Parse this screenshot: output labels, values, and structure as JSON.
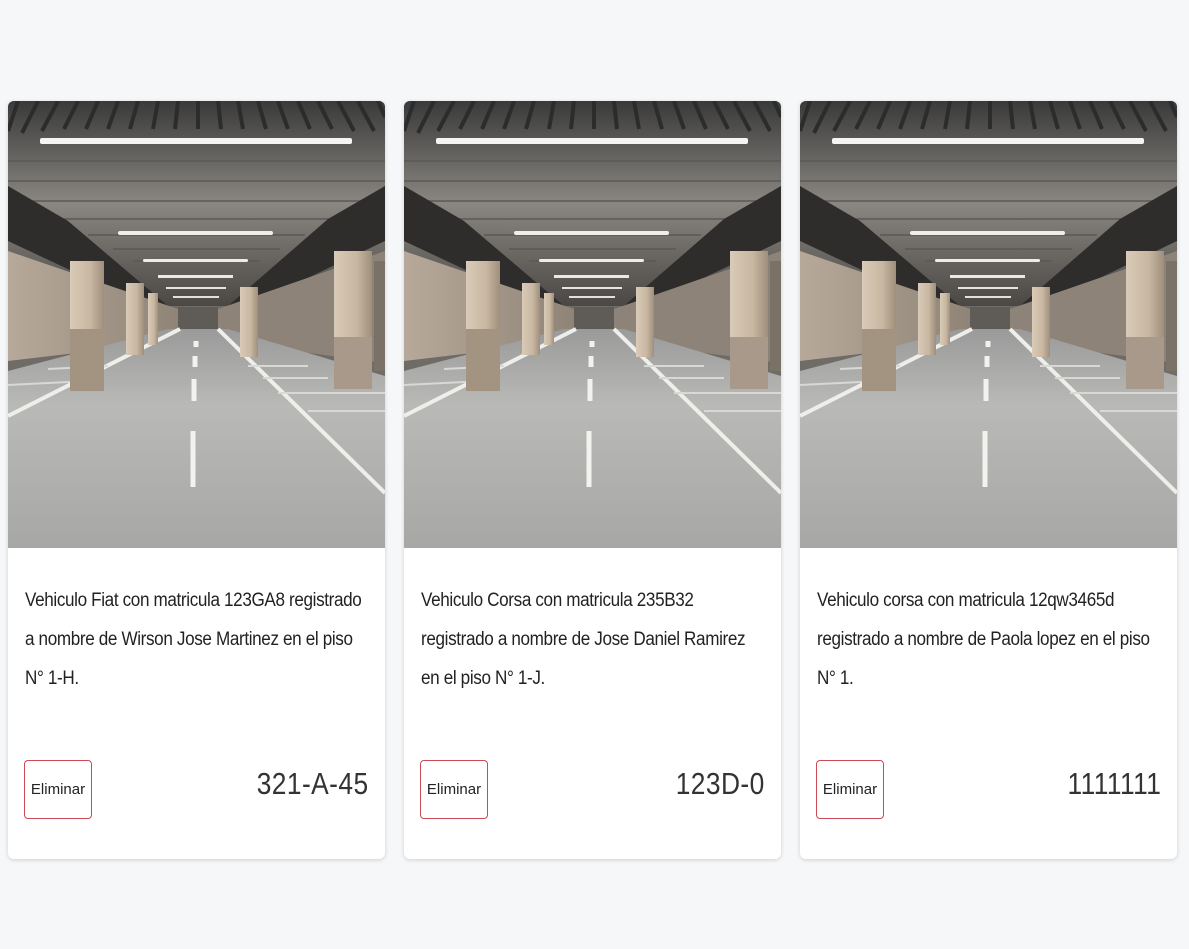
{
  "cards": [
    {
      "description": "Vehiculo Fiat con matricula 123GA8 registrado a nombre de Wirson Jose Martinez en el piso N° 1-H.",
      "button_label": "Eliminar",
      "plate": "321-A-45"
    },
    {
      "description": "Vehiculo Corsa con matricula 235B32 registrado a nombre de Jose Daniel Ramirez en el piso N° 1-J.",
      "button_label": "Eliminar",
      "plate": "123D-0"
    },
    {
      "description": "Vehiculo corsa con matricula 12qw3465d registrado a nombre de Paola lopez en el piso N° 1.",
      "button_label": "Eliminar",
      "plate": "1111111"
    }
  ],
  "colors": {
    "page_background": "#f6f7f9",
    "button_border": "#cc4a55"
  }
}
